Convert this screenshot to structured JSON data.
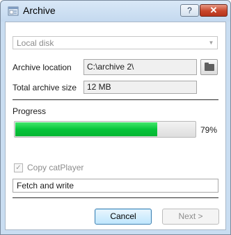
{
  "window": {
    "title": "Archive",
    "help_label": "?",
    "close_label": "✕"
  },
  "source": {
    "selected": "Local disk"
  },
  "archive_location": {
    "label": "Archive location",
    "value": "C:\\archive 2\\"
  },
  "total_size": {
    "label": "Total archive size",
    "value": "12 MB"
  },
  "progress": {
    "label": "Progress",
    "percent": 79,
    "percent_text": "79%",
    "fill_color": "#06c43a"
  },
  "copy_player": {
    "label": "Copy catPlayer",
    "checked": true,
    "enabled": false
  },
  "status": {
    "text": "Fetch and write"
  },
  "buttons": {
    "cancel": "Cancel",
    "next": "Next >"
  },
  "icons": {
    "app": "archive-window-icon",
    "browse": "folder-icon",
    "dropdown": "chevron-down-icon",
    "check": "checkmark-icon"
  }
}
